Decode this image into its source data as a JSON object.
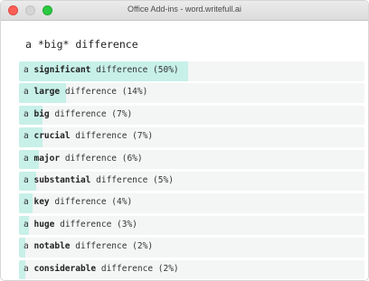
{
  "window": {
    "title": "Office Add-ins - word.writefull.ai"
  },
  "query": "a *big* difference",
  "results": [
    {
      "prefix": "a",
      "word": "significant",
      "suffix": "difference (50%)",
      "share": 0.5
    },
    {
      "prefix": "a",
      "word": "large",
      "suffix": "difference (14%)",
      "share": 0.14
    },
    {
      "prefix": "a",
      "word": "big",
      "suffix": "difference (7%)",
      "share": 0.07
    },
    {
      "prefix": "a",
      "word": "crucial",
      "suffix": "difference (7%)",
      "share": 0.07
    },
    {
      "prefix": "a",
      "word": "major",
      "suffix": "difference (6%)",
      "share": 0.06
    },
    {
      "prefix": "a",
      "word": "substantial",
      "suffix": "difference (5%)",
      "share": 0.05
    },
    {
      "prefix": "a",
      "word": "key",
      "suffix": "difference (4%)",
      "share": 0.04
    },
    {
      "prefix": "a",
      "word": "huge",
      "suffix": "difference (3%)",
      "share": 0.03
    },
    {
      "prefix": "a",
      "word": "notable",
      "suffix": "difference (2%)",
      "share": 0.02
    },
    {
      "prefix": "a",
      "word": "considerable",
      "suffix": "difference (2%)",
      "share": 0.02
    }
  ],
  "colors": {
    "bar": "#c7f0e8",
    "row_background": "#f4f5f5"
  }
}
